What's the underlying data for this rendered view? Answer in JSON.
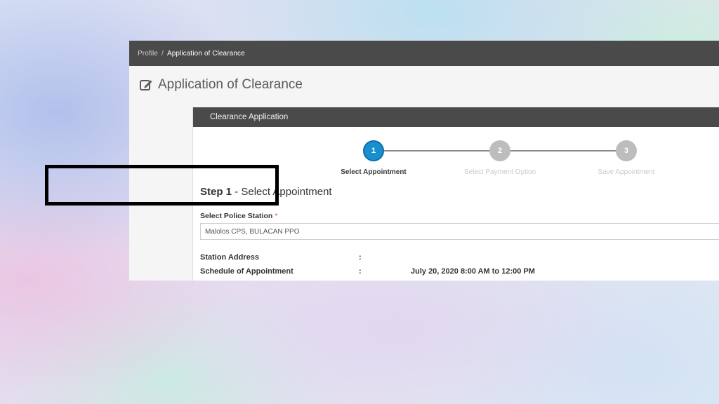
{
  "breadcrumb": {
    "items": [
      "Profile",
      "Application of Clearance"
    ],
    "separator": "/"
  },
  "page": {
    "title": "Application of Clearance",
    "title_icon": "edit-icon"
  },
  "panel": {
    "header": "Clearance Application"
  },
  "stepper": {
    "steps": [
      {
        "number": "1",
        "label": "Select Appointment",
        "state": "active"
      },
      {
        "number": "2",
        "label": "Select Payment Option",
        "state": "inactive"
      },
      {
        "number": "3",
        "label": "Save Appointment",
        "state": "inactive"
      }
    ]
  },
  "step_heading": {
    "prefix": "Step 1",
    "text": " - Select Appointment"
  },
  "form": {
    "station_label": "Select Police Station",
    "required_mark": "*",
    "station_value": "Malolos CPS, BULACAN PPO"
  },
  "info": {
    "address_label": "Station Address",
    "address_colon": ":",
    "address_value": "",
    "schedule_label": "Schedule of Appointment",
    "schedule_colon": ":",
    "schedule_value": "July 20, 2020 8:00 AM to 12:00 PM"
  },
  "colors": {
    "accent": "#1a8fd0",
    "header_bar": "#4a4a4a",
    "required": "#d9534f"
  }
}
